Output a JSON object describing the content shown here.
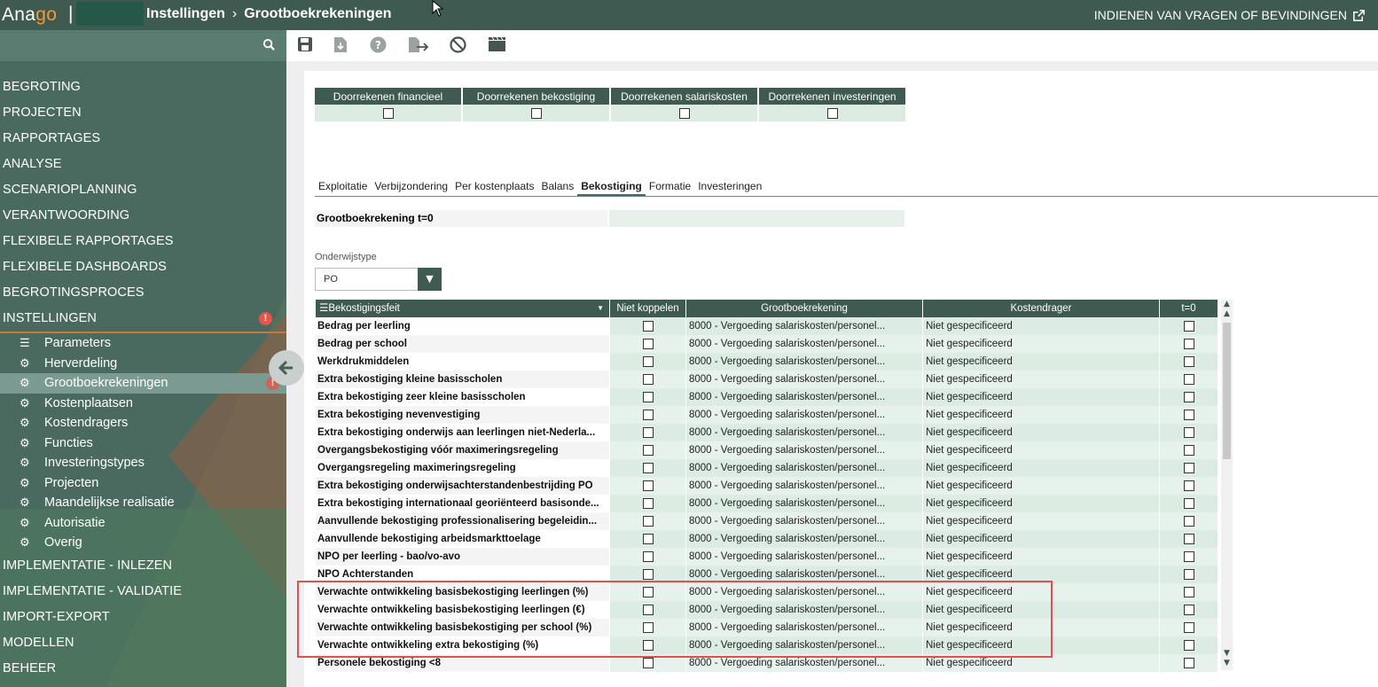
{
  "topbar": {
    "logo_ana": "Ana",
    "logo_go": "go",
    "separator": "|",
    "breadcrumb": [
      "Instellingen",
      "Grootboekrekeningen"
    ],
    "breadcrumb_sep": "›",
    "report_link": "INDIENEN VAN VRAGEN OF BEVINDINGEN"
  },
  "sidebar": {
    "menu": [
      {
        "label": "BEGROTING"
      },
      {
        "label": "PROJECTEN"
      },
      {
        "label": "RAPPORTAGES"
      },
      {
        "label": "ANALYSE"
      },
      {
        "label": "SCENARIOPLANNING"
      },
      {
        "label": "VERANTWOORDING"
      },
      {
        "label": "FLEXIBELE RAPPORTAGES"
      },
      {
        "label": "FLEXIBELE DASHBOARDS"
      },
      {
        "label": "BEGROTINGSPROCES"
      },
      {
        "label": "INSTELLINGEN",
        "alert": "!"
      }
    ],
    "submenu": [
      {
        "label": "Parameters",
        "icon": "sliders-icon"
      },
      {
        "label": "Herverdeling",
        "icon": "gear-icon"
      },
      {
        "label": "Grootboekrekeningen",
        "icon": "gear-icon",
        "active": true,
        "alert": "!"
      },
      {
        "label": "Kostenplaatsen",
        "icon": "gear-icon"
      },
      {
        "label": "Kostendragers",
        "icon": "gear-icon"
      },
      {
        "label": "Functies",
        "icon": "gear-icon"
      },
      {
        "label": "Investeringstypes",
        "icon": "gear-icon"
      },
      {
        "label": "Projecten",
        "icon": "gear-icon"
      },
      {
        "label": "Maandelijkse realisatie",
        "icon": "gear-icon"
      },
      {
        "label": "Autorisatie",
        "icon": "gear-icon"
      },
      {
        "label": "Overig",
        "icon": "gear-icon"
      }
    ],
    "menu_bottom": [
      {
        "label": "IMPLEMENTATIE - INLEZEN"
      },
      {
        "label": "IMPLEMENTATIE - VALIDATIE"
      },
      {
        "label": "IMPORT-EXPORT"
      },
      {
        "label": "MODELLEN"
      },
      {
        "label": "BEHEER"
      }
    ]
  },
  "doorrekenen": {
    "headers": [
      "Doorrekenen financieel",
      "Doorrekenen bekostiging",
      "Doorrekenen salariskosten",
      "Doorrekenen investeringen"
    ]
  },
  "tabs": [
    "Exploitatie",
    "Verbijzondering",
    "Per kostenplaats",
    "Balans",
    "Bekostiging",
    "Formatie",
    "Investeringen"
  ],
  "active_tab": "Bekostiging",
  "grootboek_t0": {
    "label": "Grootboekrekening t=0",
    "value": ""
  },
  "onderwijstype": {
    "label": "Onderwijstype",
    "value": "PO"
  },
  "grid": {
    "headers": [
      "Bekostigingsfeit",
      "Niet koppelen",
      "Grootboekrekening",
      "Kostendrager",
      "t=0"
    ],
    "rows": [
      {
        "feit": "Bedrag per leerling",
        "gb": "8000 - Vergoeding salariskosten/personel...",
        "kd": "Niet gespecificeerd"
      },
      {
        "feit": "Bedrag per school",
        "gb": "8000 - Vergoeding salariskosten/personel...",
        "kd": "Niet gespecificeerd"
      },
      {
        "feit": "Werkdrukmiddelen",
        "gb": "8000 - Vergoeding salariskosten/personel...",
        "kd": "Niet gespecificeerd"
      },
      {
        "feit": "Extra bekostiging kleine basisscholen",
        "gb": "8000 - Vergoeding salariskosten/personel...",
        "kd": "Niet gespecificeerd"
      },
      {
        "feit": "Extra bekostiging zeer kleine basisscholen",
        "gb": "8000 - Vergoeding salariskosten/personel...",
        "kd": "Niet gespecificeerd"
      },
      {
        "feit": "Extra bekostiging nevenvestiging",
        "gb": "8000 - Vergoeding salariskosten/personel...",
        "kd": "Niet gespecificeerd"
      },
      {
        "feit": "Extra bekostiging onderwijs aan leerlingen niet-Nederla...",
        "gb": "8000 - Vergoeding salariskosten/personel...",
        "kd": "Niet gespecificeerd"
      },
      {
        "feit": "Overgangsbekostiging vóór maximeringsregeling",
        "gb": "8000 - Vergoeding salariskosten/personel...",
        "kd": "Niet gespecificeerd"
      },
      {
        "feit": "Overgangsregeling maximeringsregeling",
        "gb": "8000 - Vergoeding salariskosten/personel...",
        "kd": "Niet gespecificeerd"
      },
      {
        "feit": "Extra bekostiging onderwijsachterstandenbestrijding PO",
        "gb": "8000 - Vergoeding salariskosten/personel...",
        "kd": "Niet gespecificeerd"
      },
      {
        "feit": "Extra bekostiging internationaal georiënteerd basisonde...",
        "gb": "8000 - Vergoeding salariskosten/personel...",
        "kd": "Niet gespecificeerd"
      },
      {
        "feit": "Aanvullende bekostiging professionalisering begeleidin...",
        "gb": "8000 - Vergoeding salariskosten/personel...",
        "kd": "Niet gespecificeerd"
      },
      {
        "feit": "Aanvullende bekostiging arbeidsmarkttoelage",
        "gb": "8000 - Vergoeding salariskosten/personel...",
        "kd": "Niet gespecificeerd"
      },
      {
        "feit": "NPO per leerling - bao/vo-avo",
        "gb": "8000 - Vergoeding salariskosten/personel...",
        "kd": "Niet gespecificeerd"
      },
      {
        "feit": "NPO Achterstanden",
        "gb": "8000 - Vergoeding salariskosten/personel...",
        "kd": "Niet gespecificeerd"
      },
      {
        "feit": "Verwachte ontwikkeling basisbekostiging leerlingen (%)",
        "gb": "8000 - Vergoeding salariskosten/personel...",
        "kd": "Niet gespecificeerd"
      },
      {
        "feit": "Verwachte ontwikkeling basisbekostiging leerlingen (€)",
        "gb": "8000 - Vergoeding salariskosten/personel...",
        "kd": "Niet gespecificeerd"
      },
      {
        "feit": "Verwachte ontwikkeling basisbekostiging per school (%)",
        "gb": "8000 - Vergoeding salariskosten/personel...",
        "kd": "Niet gespecificeerd"
      },
      {
        "feit": "Verwachte ontwikkeling extra bekostiging (%)",
        "gb": "8000 - Vergoeding salariskosten/personel...",
        "kd": "Niet gespecificeerd"
      },
      {
        "feit": "Personele bekostiging <8",
        "gb": "8000 - Vergoeding salariskosten/personel...",
        "kd": "Niet gespecificeerd"
      }
    ]
  },
  "colors": {
    "topbar": "#3f5a51",
    "sidebar": "#4a6a60",
    "accent": "#f29a3a",
    "highlight": "#e05050"
  }
}
